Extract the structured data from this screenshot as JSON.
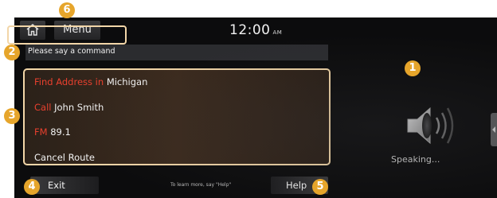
{
  "clock": {
    "time": "12:00",
    "ampm": "AM"
  },
  "topbar": {
    "menu_label": "Menu"
  },
  "command_prompt": "Please say a command",
  "commands": [
    {
      "keyword": "Find Address in",
      "value": "Michigan"
    },
    {
      "keyword": "Call",
      "value": "John Smith"
    },
    {
      "keyword": "FM",
      "value": "89.1"
    },
    {
      "keyword": "",
      "value": "Cancel Route"
    }
  ],
  "bottombar": {
    "exit_label": "Exit",
    "help_label": "Help",
    "hint": "To learn more, say \"Help\""
  },
  "status": {
    "speaking": "Speaking..."
  },
  "callouts": [
    "1",
    "2",
    "3",
    "4",
    "5",
    "6"
  ],
  "colors": {
    "highlight": "#e8402e",
    "callout": "#e6a52b",
    "outline": "#f2d6a8"
  }
}
